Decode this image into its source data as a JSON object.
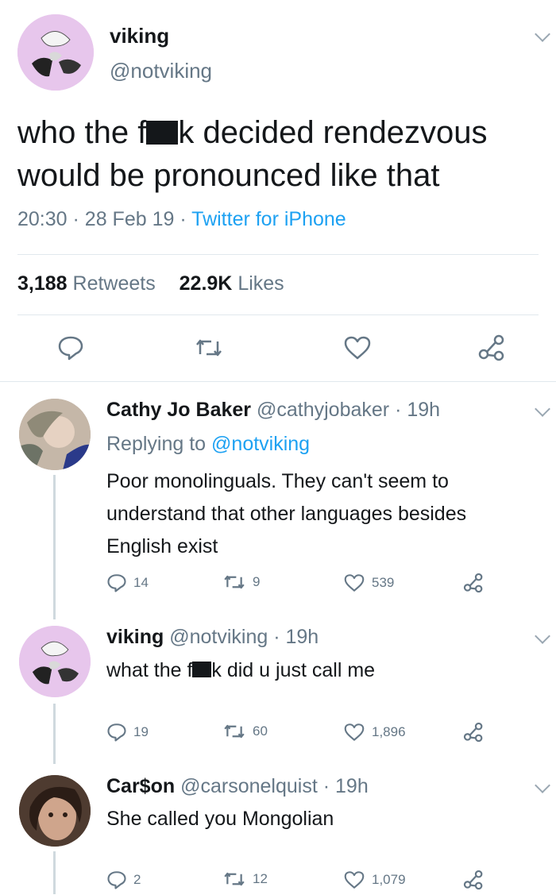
{
  "main_tweet": {
    "display_name": "viking",
    "handle": "@notviking",
    "text_part1": "who the f",
    "text_part2": "k decided rendezvous",
    "text_line2": "would be pronounced like that",
    "time": "20:30",
    "date": "28 Feb 19",
    "source": "Twitter for iPhone",
    "retweets_count": "3,188",
    "retweets_label": "Retweets",
    "likes_count": "22.9K",
    "likes_label": "Likes"
  },
  "replies": [
    {
      "display_name": "Cathy Jo Baker",
      "handle": "@cathyjobaker",
      "time": "· 19h",
      "replying_prefix": "Replying to",
      "replying_handle": "@notviking",
      "lines": [
        "Poor monolinguals. They can't seem to",
        "understand that other languages besides",
        "English exist"
      ],
      "replies": "14",
      "retweets": "9",
      "likes": "539"
    },
    {
      "display_name": "viking",
      "handle": "@notviking",
      "time": "· 19h",
      "text_part1": "what the f",
      "text_part2": "k did u just call me",
      "replies": "19",
      "retweets": "60",
      "likes": "1,896"
    },
    {
      "display_name": "Car$on",
      "handle": "@carsonelquist",
      "time": "· 19h",
      "text": "She called you Mongolian",
      "replies": "2",
      "retweets": "12",
      "likes": "1,079"
    }
  ],
  "colors": {
    "text": "#14171a",
    "secondary": "#657786",
    "accent": "#1da1f2",
    "divider": "#e1e8ed"
  }
}
